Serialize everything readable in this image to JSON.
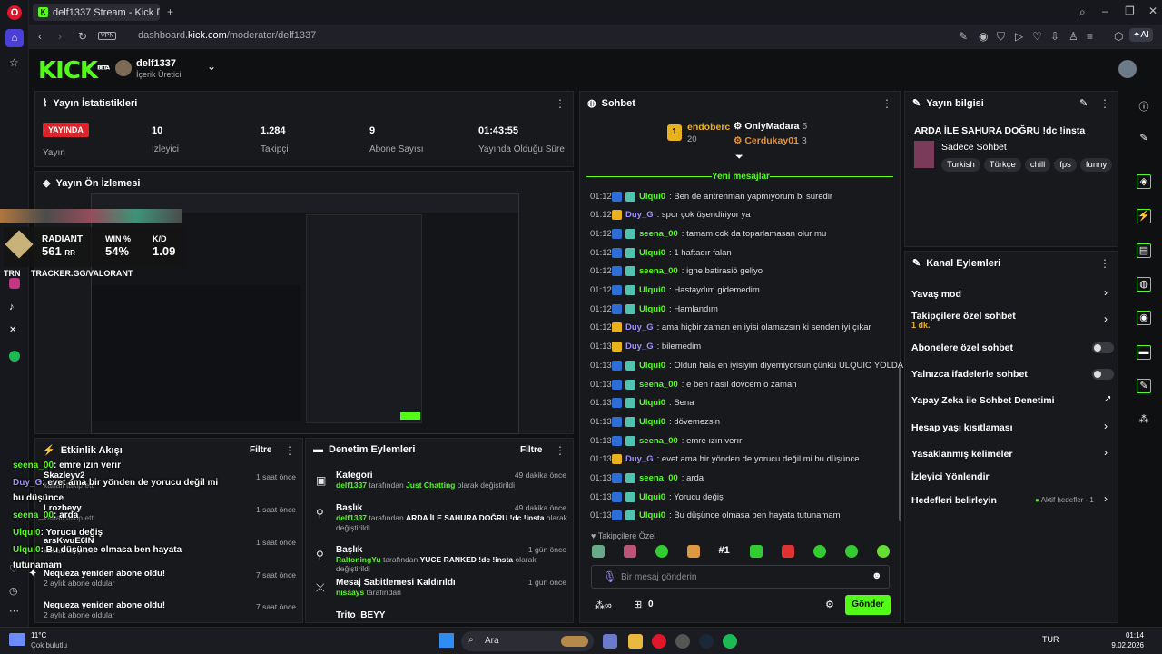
{
  "browser": {
    "tab_title": "delf1337 Stream - Kick Da",
    "url_host": "dashboard.kick.com",
    "url_prefix": "dashboard.",
    "url_domain": "kick.com",
    "url_path": "/moderator/delf1337",
    "vpn_label": "VPN",
    "ai_label": "AI"
  },
  "header": {
    "logo": "KICK",
    "logo_badge": "BETA",
    "username": "delf1337",
    "role": "İçerik Üretici"
  },
  "stats": {
    "title": "Yayın İstatistikleri",
    "live_badge": "YAYINDA",
    "live_label": "Yayın",
    "items": [
      {
        "value": "10",
        "label": "İzleyici"
      },
      {
        "value": "1.284",
        "label": "Takipçi"
      },
      {
        "value": "9",
        "label": "Abone Sayısı"
      },
      {
        "value": "01:43:55",
        "label": "Yayında Olduğu Süre"
      }
    ]
  },
  "preview": {
    "title": "Yayın Ön İzlemesi",
    "overlay": {
      "rank": "RADIANT",
      "rr": "561",
      "rr_unit": "RR",
      "win_label": "WIN %",
      "win_value": "54%",
      "kd_label": "K/D",
      "kd_value": "1.09",
      "tracker": "TRACKER.GG/VALORANT",
      "trn": "TRN"
    }
  },
  "events": {
    "title": "Etkinlik Akışı",
    "filter": "Filtre",
    "items": [
      {
        "name": "Skazleyv2",
        "sub": "kanalı takip etti",
        "time": "1 saat önce"
      },
      {
        "name": "Lrozbeyy",
        "sub": "kanalı takip etti",
        "time": "1 saat önce"
      },
      {
        "name": "arsKwuE6IN",
        "sub": "kanalı takip etti",
        "time": "1 saat önce"
      },
      {
        "name": "Nequeza yeniden abone oldu!",
        "sub": "2 aylık abone oldular",
        "time": "7 saat önce"
      },
      {
        "name": "Nequeza yeniden abone oldu!",
        "sub": "2 aylık abone oldular",
        "time": "7 saat önce"
      }
    ]
  },
  "overlay_chat": [
    {
      "user": "seena_00",
      "msg": ": emre ızın verır",
      "color": "#53fc18"
    },
    {
      "user": "Duy_G",
      "msg": ": evet ama bir yönden de yorucu değil mi",
      "color": "#a18ef7"
    },
    {
      "user": "",
      "msg": "bu düşünce",
      "color": "#fff"
    },
    {
      "user": "seena_00",
      "msg": ": arda",
      "color": "#53fc18"
    },
    {
      "user": "Ulqui0",
      "msg": ": Yorucu değiş",
      "color": "#53fc18"
    },
    {
      "user": "Ulqui0",
      "msg": ": Bu düşünce olmasa ben hayata",
      "color": "#53fc18"
    },
    {
      "user": "",
      "msg": "tutunamam",
      "color": "#fff"
    }
  ],
  "mod_actions": {
    "title": "Denetim Eylemleri",
    "filter": "Filtre",
    "items": [
      {
        "title": "Kategori",
        "actor": "delf1337",
        "mid": " tarafından ",
        "target": "Just Chatting",
        "tail": " olarak değiştirildi",
        "time": "49 dakika önce"
      },
      {
        "title": "Başlık",
        "actor": "delf1337",
        "mid": " tarafından ",
        "target": "ARDA İLE SAHURA DOĞRU !dc !insta",
        "tail": " olarak değiştirildi",
        "time": "49 dakika önce"
      },
      {
        "title": "Başlık",
        "actor": "RaltoningYu",
        "mid": " tarafından ",
        "target": "YUCE RANKED !dc !insta",
        "tail": " olarak değiştirildi",
        "time": "1 gün önce"
      },
      {
        "title": "Mesaj Sabitlemesi Kaldırıldı",
        "actor": "nisaays",
        "mid": " tarafından",
        "target": "",
        "tail": "",
        "time": "1 gün önce"
      },
      {
        "title": "Trito_BEYY",
        "actor": "",
        "mid": "",
        "target": "",
        "tail": "",
        "time": ""
      }
    ]
  },
  "chat": {
    "title": "Sohbet",
    "top": [
      {
        "name": "endoberc",
        "count": "20"
      },
      {
        "name": "OnlyMadara",
        "count": "5"
      },
      {
        "name": "Cerdukay01",
        "count": "3"
      }
    ],
    "new_messages": "Yeni mesajlar",
    "messages": [
      {
        "time": "01:12",
        "user": "Ulqui0",
        "msg": "Ben de antrenman yapmıyorum bi süredir",
        "color": "#53fc18"
      },
      {
        "time": "01:12",
        "user": "Duy_G",
        "msg": "spor çok üşendiriyor ya",
        "color": "#a18ef7"
      },
      {
        "time": "01:12",
        "user": "seena_00",
        "msg": "tamam cok da toparlamasan olur mu",
        "color": "#53fc18"
      },
      {
        "time": "01:12",
        "user": "Ulqui0",
        "msg": "1 haftadır falan",
        "color": "#53fc18"
      },
      {
        "time": "01:12",
        "user": "seena_00",
        "msg": "igne batirasiö geliyo",
        "color": "#53fc18"
      },
      {
        "time": "01:12",
        "user": "Ulqui0",
        "msg": "Hastaydım gidemedim",
        "color": "#53fc18"
      },
      {
        "time": "01:12",
        "user": "Ulqui0",
        "msg": "Hamlandım",
        "color": "#53fc18"
      },
      {
        "time": "01:12",
        "user": "Duy_G",
        "msg": "ama hiçbir zaman en iyisi olamazsın ki senden iyi çıkar",
        "color": "#a18ef7"
      },
      {
        "time": "01:13",
        "user": "Duy_G",
        "msg": "bilemedim",
        "color": "#a18ef7"
      },
      {
        "time": "01:13",
        "user": "Ulqui0",
        "msg": "Oldun hala en iyisiyim diyemiyorsun çünkü ULQUIO YOLDA",
        "color": "#53fc18"
      },
      {
        "time": "01:13",
        "user": "seena_00",
        "msg": "e ben nasıl dovcem o zaman",
        "color": "#53fc18"
      },
      {
        "time": "01:13",
        "user": "Ulqui0",
        "msg": "Sena",
        "color": "#53fc18"
      },
      {
        "time": "01:13",
        "user": "Ulqui0",
        "msg": "dövemezsin",
        "color": "#53fc18"
      },
      {
        "time": "01:13",
        "user": "seena_00",
        "msg": "emre ızın verır",
        "color": "#53fc18"
      },
      {
        "time": "01:13",
        "user": "Duy_G",
        "msg": "evet ama bir yönden de yorucu değil mi bu düşünce",
        "color": "#a18ef7"
      },
      {
        "time": "01:13",
        "user": "seena_00",
        "msg": "arda",
        "color": "#53fc18"
      },
      {
        "time": "01:13",
        "user": "Ulqui0",
        "msg": "Yorucu değiş",
        "color": "#53fc18"
      },
      {
        "time": "01:13",
        "user": "Ulqui0",
        "msg": "Bu düşünce olmasa ben hayata tutunamam",
        "color": "#53fc18"
      }
    ],
    "followers_only": "Takipçilere Özel",
    "input_placeholder": "Bir mesaj gönderin",
    "points": "0",
    "send": "Gönder"
  },
  "stream_info": {
    "title": "Yayın bilgisi",
    "stream_title": "ARDA İLE SAHURA DOĞRU !dc !insta",
    "category": "Sadece Sohbet",
    "tags": [
      "Turkish",
      "Türkçe",
      "chill",
      "fps",
      "funny"
    ]
  },
  "channel_actions": {
    "title": "Kanal Eylemleri",
    "items": [
      {
        "label": "Yavaş mod",
        "sub": "",
        "control": "chevron"
      },
      {
        "label": "Takipçilere özel sohbet",
        "sub": "1 dk.",
        "control": "chevron"
      },
      {
        "label": "Abonelere özel sohbet",
        "sub": "",
        "control": "toggle"
      },
      {
        "label": "Yalnızca ifadelerle sohbet",
        "sub": "",
        "control": "toggle"
      },
      {
        "label": "Yapay Zeka ile Sohbet Denetimi",
        "sub": "",
        "control": "external"
      },
      {
        "label": "Hesap yaşı kısıtlaması",
        "sub": "",
        "control": "chevron"
      },
      {
        "label": "Yasaklanmış kelimeler",
        "sub": "",
        "control": "chevron"
      },
      {
        "label": "İzleyici Yönlendir",
        "sub": "",
        "control": "none"
      },
      {
        "label": "Hedefleri belirleyin",
        "sub": "",
        "control": "chevron",
        "status": "Aktif hedefler - 1"
      }
    ]
  },
  "taskbar": {
    "weather_temp": "11°C",
    "weather_desc": "Çok bulutlu",
    "search": "Ara",
    "lang": "TUR",
    "time": "01:14",
    "date": "9.02.2026"
  },
  "colors": {
    "brand": "#53fc18",
    "live": "#d8262c",
    "panel": "#18191d"
  }
}
